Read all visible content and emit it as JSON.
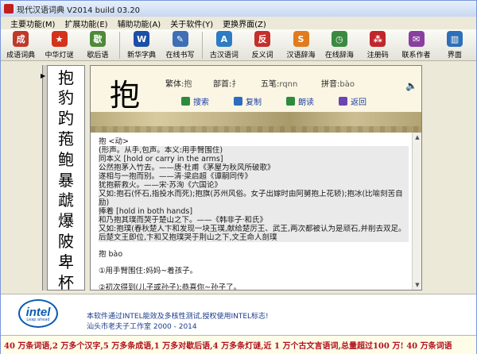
{
  "window": {
    "title": "现代汉语词典 V2014 build 03.20"
  },
  "menu": [
    "主要功能(M)",
    "扩展功能(E)",
    "辅助功能(A)",
    "关于软件(Y)",
    "更换界面(Z)"
  ],
  "toolbar": [
    {
      "label": "成语词典",
      "icon": "idiom-dict-icon",
      "color": "#c0392b",
      "glyph": "成"
    },
    {
      "label": "中华灯谜",
      "icon": "lantern-riddle-icon",
      "color": "#d4331b",
      "glyph": "★"
    },
    {
      "label": "歇后语",
      "icon": "saying-icon",
      "color": "#4f8a3a",
      "glyph": "歇"
    },
    {
      "label": "新华字典",
      "icon": "xinhua-dict-icon",
      "color": "#1c4fa6",
      "glyph": "W"
    },
    {
      "label": "在线书写",
      "icon": "online-writing-icon",
      "color": "#3f6fb4",
      "glyph": "✎"
    },
    {
      "label": "古汉语词",
      "icon": "classical-chinese-icon",
      "color": "#2d7cc4",
      "glyph": "A"
    },
    {
      "label": "反义词",
      "icon": "antonym-icon",
      "color": "#c4302b",
      "glyph": "反"
    },
    {
      "label": "汉语辞海",
      "icon": "chinese-cihai-icon",
      "color": "#e07b1e",
      "glyph": "S"
    },
    {
      "label": "在线辞海",
      "icon": "online-cihai-icon",
      "color": "#3b8a3f",
      "glyph": "◷"
    },
    {
      "label": "注册码",
      "icon": "register-code-icon",
      "color": "#c0262b",
      "glyph": "⁂"
    },
    {
      "label": "联系作者",
      "icon": "contact-author-icon",
      "color": "#8a3fa0",
      "glyph": "✉"
    },
    {
      "label": "界面",
      "icon": "interface-icon",
      "color": "#2f6fb8",
      "glyph": "▥"
    }
  ],
  "char_list": [
    "抱",
    "豹",
    "趵",
    "菢",
    "鲍",
    "暴",
    "虣",
    "爆",
    "陂",
    "卑",
    "杯"
  ],
  "entry": {
    "char": "抱",
    "traditional_label": "繁体:",
    "traditional_value": "抱",
    "radical_label": "部首:",
    "radical_value": "扌",
    "wubi_label": "五笔:",
    "wubi_value": "rqnn",
    "pinyin_label": "拼音:",
    "pinyin_value": "bào"
  },
  "actions": [
    {
      "label": "搜索",
      "color": "#2e8b3e"
    },
    {
      "label": "复制",
      "color": "#2d6cc0"
    },
    {
      "label": "朗读",
      "color": "#2e8b3e"
    },
    {
      "label": "返回",
      "color": "#6d45b0"
    }
  ],
  "content_lines": [
    "抱 <动>",
    "(形声。从手,包声。本义:用手臂围住)",
    "同本义 [hold or carry in the arms]",
    "公然抱茅入竹去。——唐·杜甫《茅屋为秋风所破歌》",
    "遂相与一抱而别。——清·梁启超《谭嗣同传》",
    "犹抱薪救火。——宋·苏洵《六国论》",
    "又如:抱石(怀石,指投水而死);抱旗(苏州风俗。女子出嫁时由阿舅抱上花轿);抱冰(比喻刻苦自励)",
    "捧着 [hold in both hands]",
    "和乃抱其璞而哭于楚山之下。——《韩非子·和氏》",
    "又如:抱璞(春秋楚人卞和发现一块玉璞,献给楚厉王、武王,两次都被认为是顽石,并削去双足。后楚文王即位,卞和又抱璞哭于荆山之下,文王命人剖璞",
    "抱 bào",
    "①用手臂围住:妈妈~着孩子。",
    "②初次得到(儿子或孙子):恭喜你~孙子了。"
  ],
  "footer": {
    "line1": "本软件通过INTEL能效及多核性测试,授权使用INTEL标志!",
    "line2": "汕头市老夫子工作室 2000 - 2014",
    "logo_text": "intel",
    "logo_sub": "Leap ahead"
  },
  "ticker": "40 万条词语,2 万多个汉字,5 万多条成语,1 万多对歇后语,4 万多条灯谜,近 1 万个古文言语词,总量超过100 万! 40 万条词语"
}
